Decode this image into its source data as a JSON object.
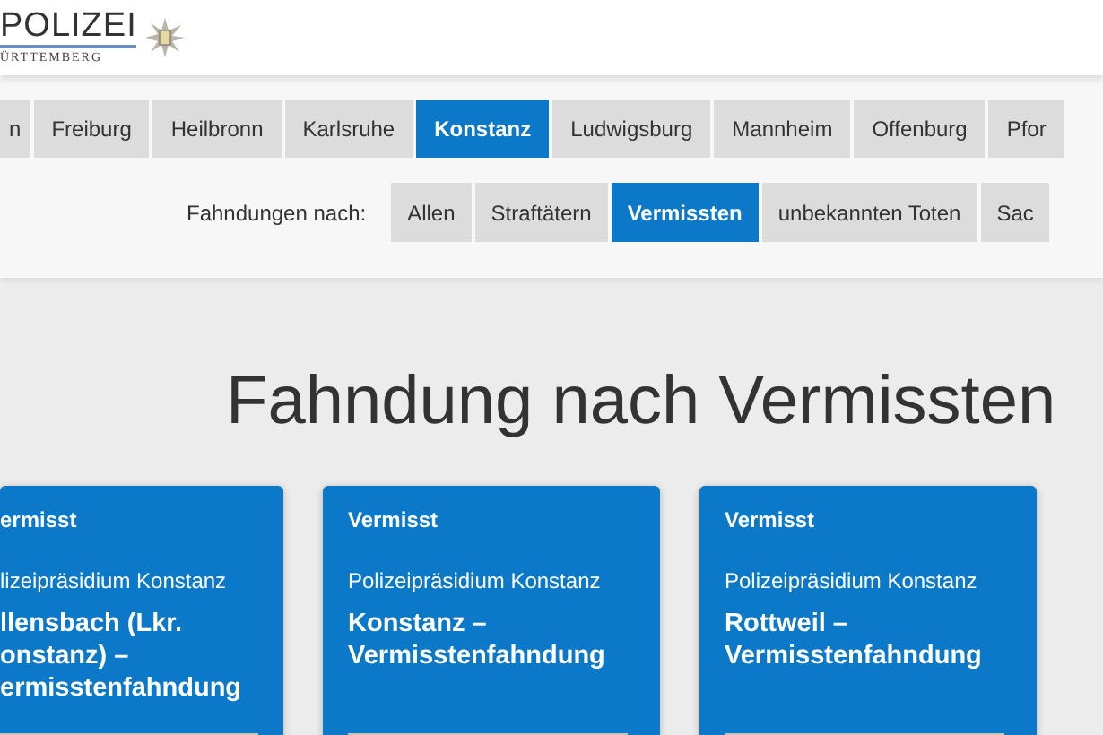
{
  "logo": {
    "title": "POLIZEI",
    "subtitle": "ÜRTTEMBERG"
  },
  "nav_tabs": [
    {
      "label": "n",
      "selected": false
    },
    {
      "label": "Freiburg",
      "selected": false
    },
    {
      "label": "Heilbronn",
      "selected": false
    },
    {
      "label": "Karlsruhe",
      "selected": false
    },
    {
      "label": "Konstanz",
      "selected": true
    },
    {
      "label": "Ludwigsburg",
      "selected": false
    },
    {
      "label": "Mannheim",
      "selected": false
    },
    {
      "label": "Offenburg",
      "selected": false
    },
    {
      "label": "Pfor",
      "selected": false
    }
  ],
  "filter": {
    "label": "Fahndungen nach:",
    "options": [
      {
        "label": "Allen",
        "selected": false
      },
      {
        "label": "Straftätern",
        "selected": false
      },
      {
        "label": "Vermissten",
        "selected": true
      },
      {
        "label": "unbekannten Toten",
        "selected": false
      },
      {
        "label": "Sac",
        "selected": false
      }
    ]
  },
  "heading": "Fahndung nach Vermissten",
  "cards": [
    {
      "category": "ermisst",
      "agency": "lizeipräsidium Konstanz",
      "title": "llensbach (Lkr. onstanz) – ermisstenfahndung"
    },
    {
      "category": "Vermisst",
      "agency": "Polizeipräsidium Konstanz",
      "title": "Konstanz – Vermisstenfahndung"
    },
    {
      "category": "Vermisst",
      "agency": "Polizeipräsidium Konstanz",
      "title": "Rottweil – Vermisstenfahndung"
    }
  ]
}
